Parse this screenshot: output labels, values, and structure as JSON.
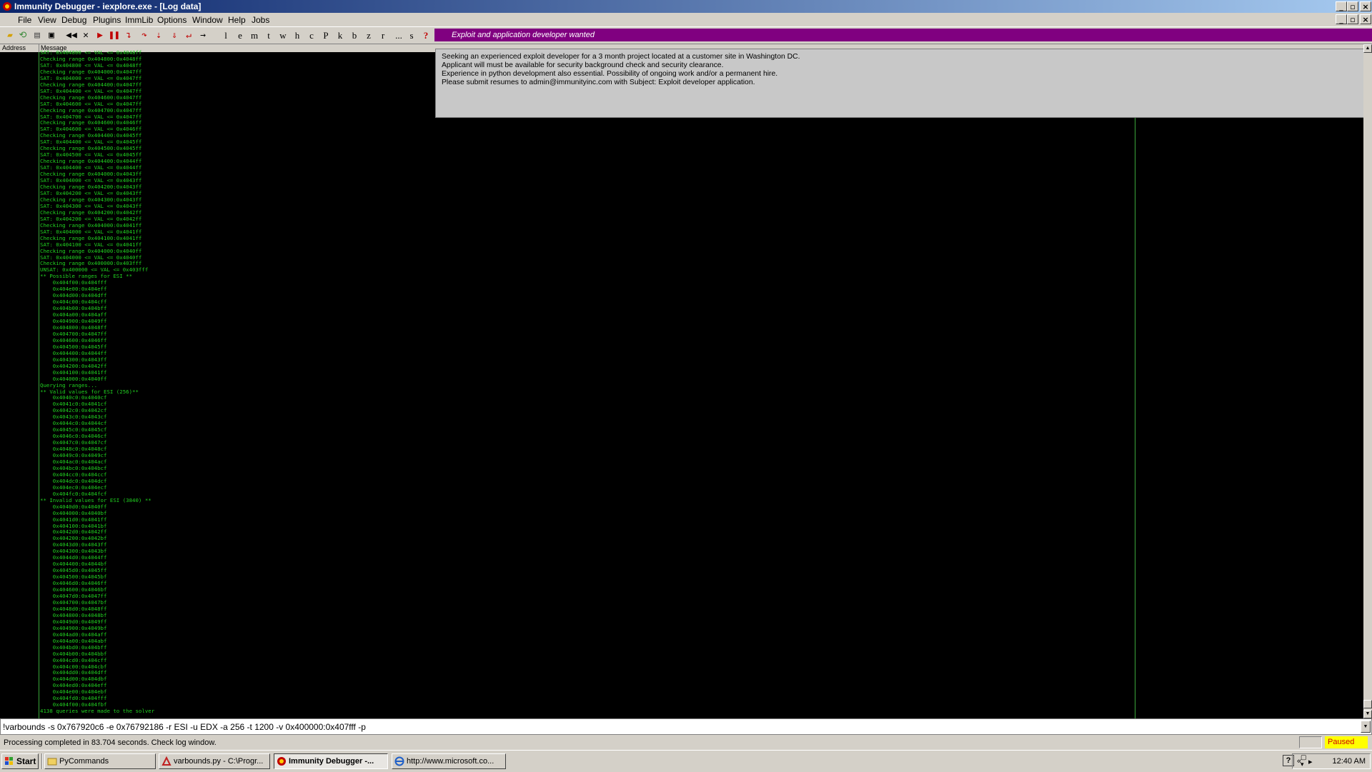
{
  "window": {
    "title": "Immunity Debugger - iexplore.exe - [Log data]"
  },
  "menu": [
    "File",
    "View",
    "Debug",
    "Plugins",
    "ImmLib",
    "Options",
    "Window",
    "Help",
    "Jobs"
  ],
  "toolbar_letters": [
    "l",
    "e",
    "m",
    "t",
    "w",
    "h",
    "c",
    "P",
    "k",
    "b",
    "z",
    "r",
    "...",
    "s",
    "?"
  ],
  "banner": "Exploit and application developer wanted",
  "columns": {
    "address": "Address",
    "message": "Message"
  },
  "notice_lines": [
    "Seeking an experienced exploit developer for a 3 month project located at a customer site in Washington DC.",
    "Applicant will must be available for security background check and security clearance.",
    "Experience in python development also essential. Possibility of ongoing work and/or a permanent hire.",
    "Please submit resumes to admin@immunityinc.com with Subject: Exploit developer application."
  ],
  "log_lines": [
    "SAT: 0x404800 <= VAL <= 0x4048ff",
    "Checking range 0x404800:0x4048ff",
    "SAT: 0x404800 <= VAL <= 0x4048ff",
    "Checking range 0x404000:0x4047ff",
    "SAT: 0x404000 <= VAL <= 0x4047ff",
    "Checking range 0x404400:0x4047ff",
    "SAT: 0x404400 <= VAL <= 0x4047ff",
    "Checking range 0x404600:0x4047ff",
    "SAT: 0x404600 <= VAL <= 0x4047ff",
    "Checking range 0x404700:0x4047ff",
    "SAT: 0x404700 <= VAL <= 0x4047ff",
    "Checking range 0x404600:0x4046ff",
    "SAT: 0x404600 <= VAL <= 0x4046ff",
    "Checking range 0x404400:0x4045ff",
    "SAT: 0x404400 <= VAL <= 0x4045ff",
    "Checking range 0x404500:0x4045ff",
    "SAT: 0x404500 <= VAL <= 0x4045ff",
    "Checking range 0x404400:0x4044ff",
    "SAT: 0x404400 <= VAL <= 0x4044ff",
    "Checking range 0x404000:0x4043ff",
    "SAT: 0x404000 <= VAL <= 0x4043ff",
    "Checking range 0x404200:0x4043ff",
    "SAT: 0x404200 <= VAL <= 0x4043ff",
    "Checking range 0x404300:0x4043ff",
    "SAT: 0x404300 <= VAL <= 0x4043ff",
    "Checking range 0x404200:0x4042ff",
    "SAT: 0x404200 <= VAL <= 0x4042ff",
    "Checking range 0x404000:0x4041ff",
    "SAT: 0x404000 <= VAL <= 0x4041ff",
    "Checking range 0x404100:0x4041ff",
    "SAT: 0x404100 <= VAL <= 0x4041ff",
    "Checking range 0x404000:0x4040ff",
    "SAT: 0x404000 <= VAL <= 0x4040ff",
    "Checking range 0x400000:0x403fff",
    "UNSAT: 0x400000 <= VAL <= 0x403fff",
    "** Possible ranges for ESI **",
    "    0x404f00:0x404fff",
    "    0x404e00:0x404eff",
    "    0x404d00:0x404dff",
    "    0x404c00:0x404cff",
    "    0x404b00:0x404bff",
    "    0x404a00:0x404aff",
    "    0x404900:0x4049ff",
    "    0x404800:0x4048ff",
    "    0x404700:0x4047ff",
    "    0x404600:0x4046ff",
    "    0x404500:0x4045ff",
    "    0x404400:0x4044ff",
    "    0x404300:0x4043ff",
    "    0x404200:0x4042ff",
    "    0x404100:0x4041ff",
    "    0x404000:0x4040ff",
    "Querying ranges...",
    "** Valid values for ESI (256)**",
    "    0x4040c0:0x4040cf",
    "    0x4041c0:0x4041cf",
    "    0x4042c0:0x4042cf",
    "    0x4043c0:0x4043cf",
    "    0x4044c0:0x4044cf",
    "    0x4045c0:0x4045cf",
    "    0x4046c0:0x4046cf",
    "    0x4047c0:0x4047cf",
    "    0x4048c0:0x4048cf",
    "    0x4049c0:0x4049cf",
    "    0x404ac0:0x404acf",
    "    0x404bc0:0x404bcf",
    "    0x404cc0:0x404ccf",
    "    0x404dc0:0x404dcf",
    "    0x404ec0:0x404ecf",
    "    0x404fc0:0x404fcf",
    "** Invalid values for ESI (3840) **",
    "    0x4040d0:0x4040ff",
    "    0x404000:0x4040bf",
    "    0x4041d0:0x4041ff",
    "    0x404100:0x4041bf",
    "    0x4042d0:0x4042ff",
    "    0x404200:0x4042bf",
    "    0x4043d0:0x4043ff",
    "    0x404300:0x4043bf",
    "    0x4044d0:0x4044ff",
    "    0x404400:0x4044bf",
    "    0x4045d0:0x4045ff",
    "    0x404500:0x4045bf",
    "    0x4046d0:0x4046ff",
    "    0x404600:0x4046bf",
    "    0x4047d0:0x4047ff",
    "    0x404700:0x4047bf",
    "    0x4048d0:0x4048ff",
    "    0x404800:0x4048bf",
    "    0x4049d0:0x4049ff",
    "    0x404900:0x4049bf",
    "    0x404ad0:0x404aff",
    "    0x404a00:0x404abf",
    "    0x404bd0:0x404bff",
    "    0x404b00:0x404bbf",
    "    0x404cd0:0x404cff",
    "    0x404c00:0x404cbf",
    "    0x404dd0:0x404dff",
    "    0x404d00:0x404dbf",
    "    0x404ed0:0x404eff",
    "    0x404e00:0x404ebf",
    "    0x404fd0:0x404fff",
    "    0x404f00:0x404fbf",
    "4138 queries were made to the solver"
  ],
  "command": {
    "value": "!varbounds -s 0x767920c6 -e 0x76792186 -r ESI -u EDX -a 256 -t 1200 -v 0x400000:0x407fff -p"
  },
  "status": {
    "text": "Processing completed in 83.704 seconds. Check log window.",
    "state": "Paused"
  },
  "taskbar": {
    "start": "Start",
    "tasks": [
      {
        "label": "PyCommands",
        "icon": "folder-icon"
      },
      {
        "label": "varbounds.py - C:\\Progr...",
        "icon": "editor-icon"
      },
      {
        "label": "Immunity Debugger -...",
        "icon": "debugger-icon"
      },
      {
        "label": "http://www.microsoft.co...",
        "icon": "browser-icon"
      }
    ],
    "clock": "12:40 AM"
  },
  "colors": {
    "log_text": "#21d121",
    "banner_bg": "#800080",
    "paused_bg": "#ffff00",
    "paused_text": "#cc0000"
  }
}
